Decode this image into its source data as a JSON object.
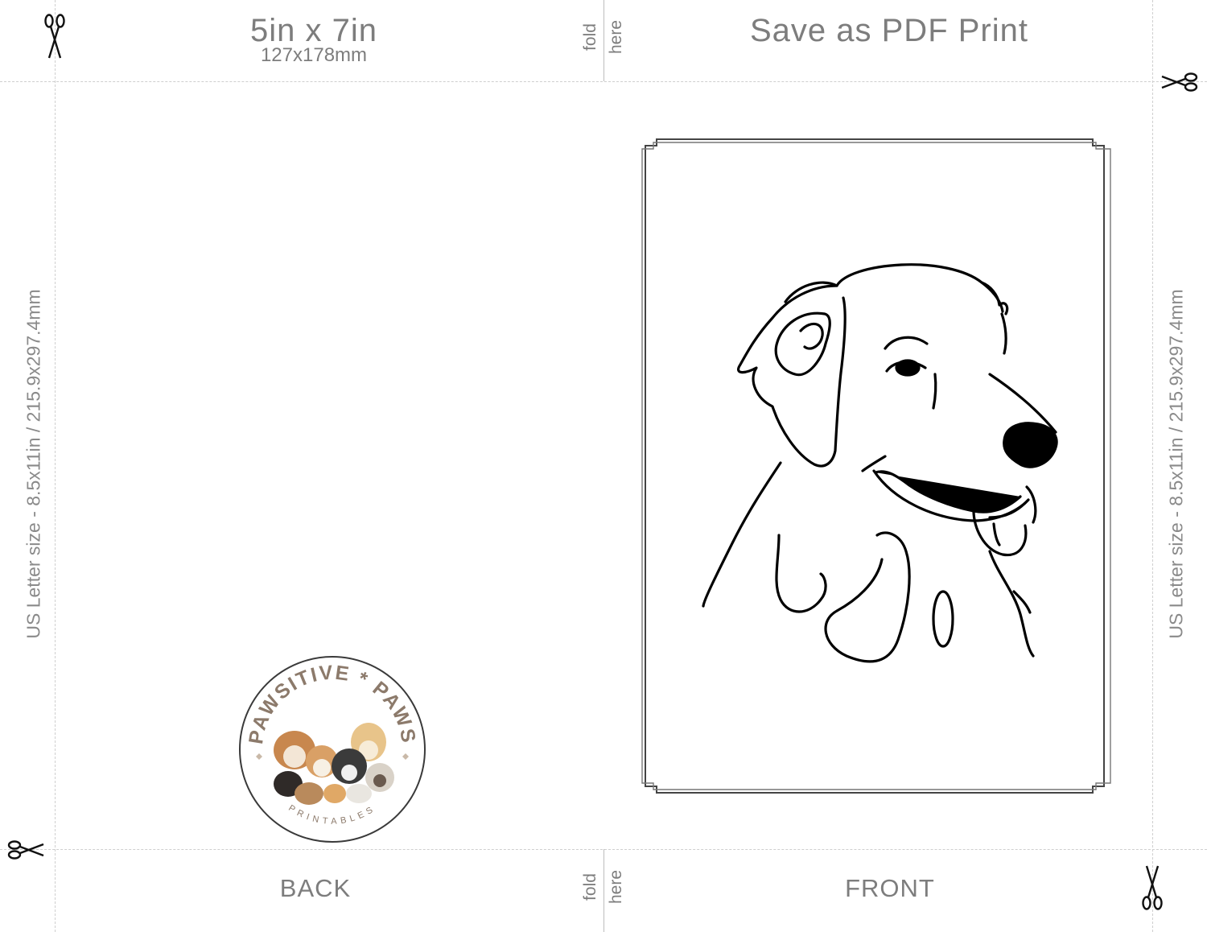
{
  "header": {
    "size_label": "5in x 7in",
    "size_metric": "127x178mm",
    "fold_word_1": "fold",
    "fold_word_2": "here",
    "print_label": "Save as PDF Print"
  },
  "footer": {
    "back_label": "BACK",
    "front_label": "FRONT",
    "fold_word_1": "fold",
    "fold_word_2": "here"
  },
  "side": {
    "left_label": "US Letter size - 8.5x11in / 215.9x297.4mm",
    "right_label": "US Letter size - 8.5x11in / 215.9x297.4mm"
  },
  "logo": {
    "top_text": "PAWSITIVE * PAWS",
    "bottom_text": "PRINTABLES",
    "ring_color": "#3a3a3a",
    "text_color": "#8c7a6b"
  },
  "icons": [
    "scissors-icon",
    "dog-line-art",
    "double-frame"
  ]
}
